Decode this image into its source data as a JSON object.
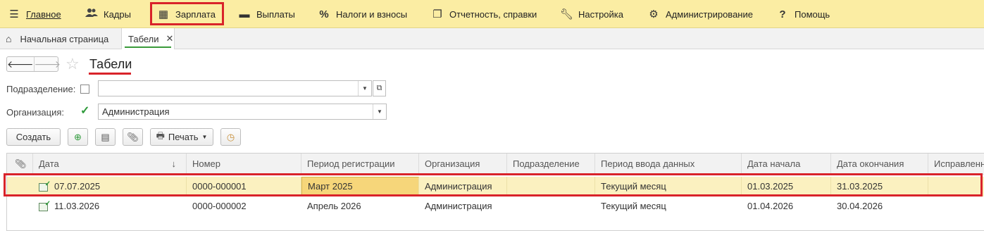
{
  "menu": {
    "items": [
      {
        "label": "Главное",
        "icon": "hamburger-icon"
      },
      {
        "label": "Кадры",
        "icon": "people-icon"
      },
      {
        "label": "Зарплата",
        "icon": "calculator-icon"
      },
      {
        "label": "Выплаты",
        "icon": "card-icon"
      },
      {
        "label": "Налоги и взносы",
        "icon": "percent-icon"
      },
      {
        "label": "Отчетность, справки",
        "icon": "documents-icon"
      },
      {
        "label": "Настройка",
        "icon": "wrench-icon"
      },
      {
        "label": "Администрирование",
        "icon": "gear-icon"
      },
      {
        "label": "Помощь",
        "icon": "question-icon"
      }
    ]
  },
  "tabs": {
    "home_label": "Начальная страница",
    "active_label": "Табели"
  },
  "page": {
    "title": "Табели"
  },
  "filters": {
    "subdivision_label": "Подразделение:",
    "subdivision_value": "",
    "subdivision_checked": false,
    "organization_label": "Организация:",
    "organization_value": "Администрация",
    "organization_checked": true
  },
  "toolbar": {
    "create_label": "Создать",
    "print_label": "Печать"
  },
  "table": {
    "columns": [
      "Дата",
      "Номер",
      "Период регистрации",
      "Организация",
      "Подразделение",
      "Период ввода данных",
      "Дата начала",
      "Дата окончания",
      "Исправленн"
    ],
    "rows": [
      {
        "date": "07.07.2025",
        "number": "0000-000001",
        "period": "Март 2025",
        "org": "Администрация",
        "subdivision": "",
        "input_period": "Текущий месяц",
        "start": "01.03.2025",
        "end": "31.03.2025",
        "fixed": ""
      },
      {
        "date": "11.03.2026",
        "number": "0000-000002",
        "period": "Апрель 2026",
        "org": "Администрация",
        "subdivision": "",
        "input_period": "Текущий месяц",
        "start": "01.04.2026",
        "end": "30.04.2026",
        "fixed": ""
      }
    ]
  },
  "colors": {
    "menu_bg": "#fbeda3",
    "highlight": "#d9232a",
    "selected_row": "#fbf1c0",
    "current_cell": "#f6d67a"
  }
}
